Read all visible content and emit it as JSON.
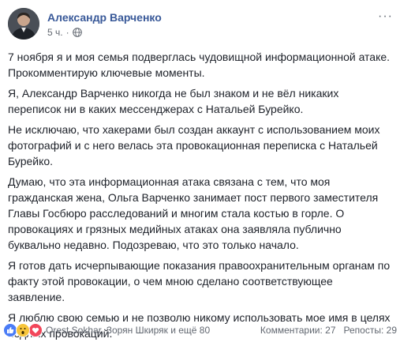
{
  "post": {
    "author": "Александр Варченко",
    "time": "5 ч.",
    "separator": "·",
    "more_label": "···",
    "paragraphs": [
      "7 ноября я и моя семья подверглась чудовищной информационной атаке. Прокомментирую ключевые моменты.",
      "Я, Александр Варченко никогда не был знаком и не вёл никаких переписок ни в каких мессенджерах с Натальей Бурейко.",
      "Не исключаю, что хакерами был создан аккаунт с использованием моих фотографий и с него велась эта провокационная переписка с Натальей Бурейко.",
      "Думаю, что эта информационная атака связана с тем, что моя гражданская жена, Ольга Варченко занимает пост первого заместителя Главы Госбюро расследований и многим стала костью в горле. О провокациях и грязных медийных атаках она заявляла публично буквально недавно. Подозреваю, что это только начало.",
      "Я готов дать исчерпывающие показания правоохранительным органам по факту этой провокации, о чем мною сделано соответствующее заявление.",
      "Я люблю свою семью и не позволю никому использовать мое имя в целях подлых провокаций."
    ]
  },
  "footer": {
    "reactors": "Orest Sokhar, Зорян Шкиряк и ещё 80",
    "comments": "Комментарии: 27",
    "shares": "Репосты: 29",
    "reaction_icons": [
      "like-icon",
      "wow-icon",
      "love-icon"
    ]
  },
  "colors": {
    "link": "#385898",
    "text": "#1d2129",
    "meta": "#616770",
    "like": "#4a7cf6",
    "wow": "#f7c53b",
    "love": "#f2465a"
  }
}
